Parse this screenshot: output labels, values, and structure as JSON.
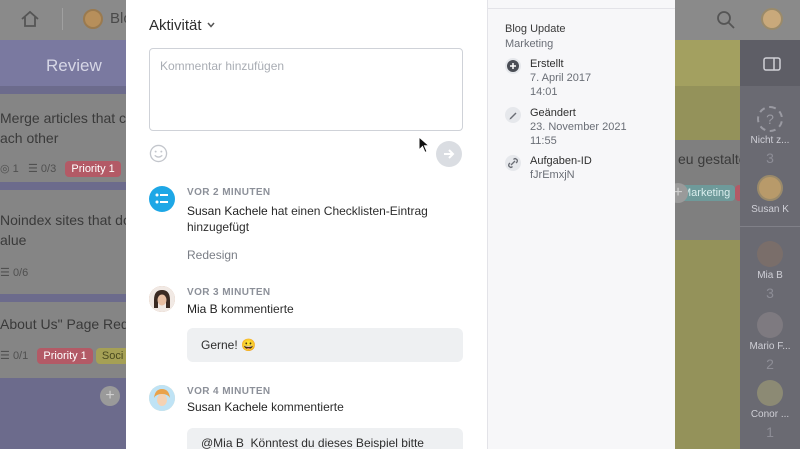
{
  "board": {
    "project_label": "Blo",
    "left_column_title": "Review",
    "left_cards": [
      {
        "title_line1": "Merge articles that ca",
        "title_line2": "ach other",
        "meta_count": "1",
        "meta_check": "0/3",
        "chip": "Priority 1"
      },
      {
        "title_line1": "Noindex sites that do",
        "title_line2": "alue",
        "meta_check": "0/6"
      },
      {
        "title_line1": "About Us\" Page Red",
        "meta_check": "0/1",
        "chip": "Priority 1",
        "chip2": "Soci"
      }
    ],
    "right_card_text": "eu gestalte",
    "right_card_chip": "Marketing"
  },
  "sidebar": {
    "people": [
      {
        "name": "Nicht z...",
        "count": "3"
      },
      {
        "name": "Susan K",
        "count": ""
      },
      {
        "name": "Mia B",
        "count": "3"
      },
      {
        "name": "Mario F...",
        "count": "2"
      },
      {
        "name": "Conor ...",
        "count": "1"
      }
    ]
  },
  "activity": {
    "header": "Aktivität",
    "comment_placeholder": "Kommentar hinzufügen",
    "entries": [
      {
        "time": "VOR 2 MINUTEN",
        "user": "Susan Kachele",
        "action_line1": " hat einen Checklisten-Eintrag",
        "action_line2": "hinzugefügt",
        "detail": "Redesign"
      },
      {
        "time": "VOR 3 MINUTEN",
        "user": "Mia B",
        "action_line1": " kommentierte",
        "comment": "Gerne! 😀"
      },
      {
        "time": "VOR 4 MINUTEN",
        "user": "Susan Kachele",
        "action_line1": " kommentierte",
        "comment_mention": "@Mia B",
        "comment": "Könntest du dieses Beispiel bitte"
      }
    ]
  },
  "details": {
    "title": "Blog Update",
    "list": "Marketing",
    "created_label": "Erstellt",
    "created_date": "7. April 2017",
    "created_time": "14:01",
    "changed_label": "Geändert",
    "changed_date": "23. November 2021",
    "changed_time": "11:55",
    "task_id_label": "Aufgaben-ID",
    "task_id": "fJrEmxjN"
  },
  "colors": {
    "accent_blue": "#1ea7e6",
    "priority_red": "#b35a66",
    "modal_bg": "#ffffff",
    "details_bg": "#f7f7f9"
  }
}
